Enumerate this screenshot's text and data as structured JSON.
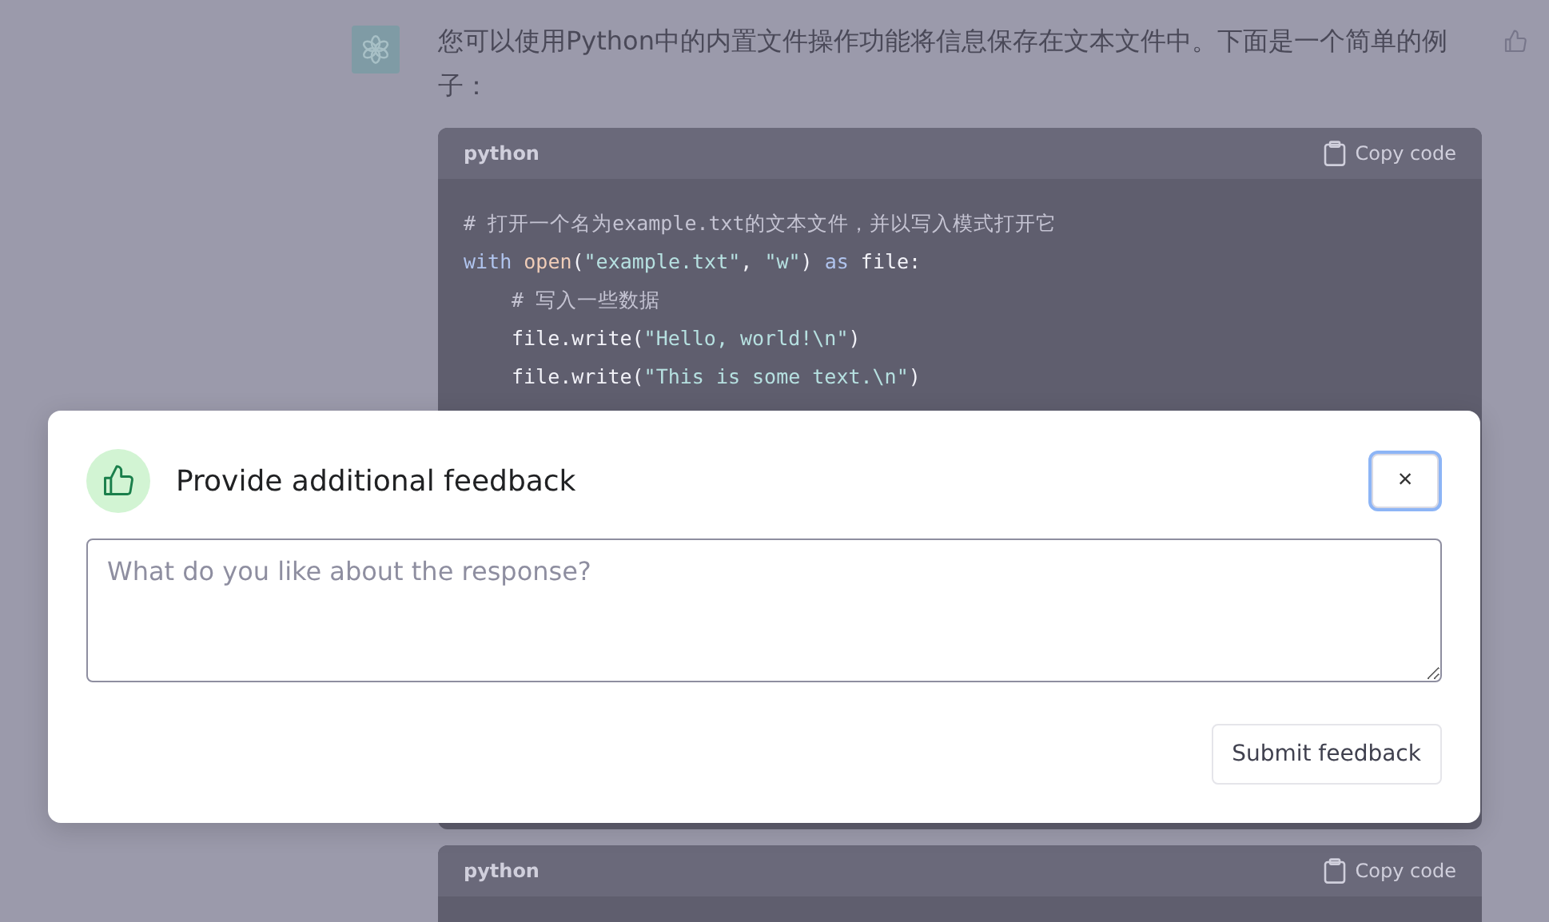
{
  "message": {
    "text": "您可以使用Python中的内置文件操作功能将信息保存在文本文件中。下面是一个简单的例子："
  },
  "code_blocks": [
    {
      "language": "python",
      "copy_label": "Copy code",
      "lines": [
        {
          "segments": [
            {
              "kind": "comment",
              "text": "# 打开一个名为example.txt的文本文件，并以写入模式打开它"
            }
          ]
        },
        {
          "segments": [
            {
              "kind": "keyword",
              "text": "with "
            },
            {
              "kind": "func",
              "text": "open"
            },
            {
              "kind": "plain",
              "text": "("
            },
            {
              "kind": "string",
              "text": "\"example.txt\""
            },
            {
              "kind": "plain",
              "text": ", "
            },
            {
              "kind": "string",
              "text": "\"w\""
            },
            {
              "kind": "plain",
              "text": ") "
            },
            {
              "kind": "keyword",
              "text": "as"
            },
            {
              "kind": "plain",
              "text": " file:"
            }
          ],
          "children": [
            {
              "segments": [
                {
                  "kind": "comment",
                  "text": "# 写入一些数据"
                }
              ]
            },
            {
              "segments": [
                {
                  "kind": "plain",
                  "text": "file.write("
                },
                {
                  "kind": "string",
                  "text": "\"Hello, world!\\n\""
                },
                {
                  "kind": "plain",
                  "text": ")"
                }
              ]
            },
            {
              "segments": [
                {
                  "kind": "plain",
                  "text": "file.write("
                },
                {
                  "kind": "string",
                  "text": "\"This is some text.\\n\""
                },
                {
                  "kind": "plain",
                  "text": ")"
                }
              ]
            }
          ]
        }
      ]
    },
    {
      "language": "python",
      "copy_label": "Copy code"
    }
  ],
  "feedback_dialog": {
    "title": "Provide additional feedback",
    "close_label": "×",
    "placeholder": "What do you like about the response?",
    "submit_label": "Submit feedback"
  }
}
